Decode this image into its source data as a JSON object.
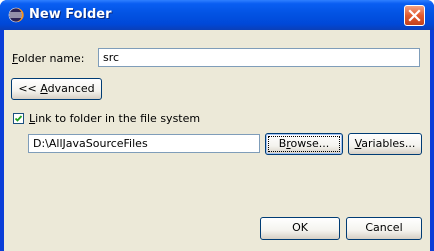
{
  "window": {
    "title": "New Folder",
    "icon": "eclipse-icon"
  },
  "folder_name": {
    "label_rest": "older name:",
    "label_mnemonic": "F",
    "value": "src"
  },
  "advanced_button": {
    "label_prefix": "<< ",
    "label_mnemonic": "A",
    "label_rest": "dvanced"
  },
  "link_checkbox": {
    "checked": true,
    "label_mnemonic": "L",
    "label_rest": "ink to folder in the file system"
  },
  "link_path": {
    "value": "D:\\AllJavaSourceFiles"
  },
  "browse_button": {
    "label_mnemonic": "r",
    "label_before": "B",
    "label_after": "owse..."
  },
  "variables_button": {
    "label_mnemonic": "V",
    "label_rest": "ariables..."
  },
  "ok_button": {
    "label": "OK"
  },
  "cancel_button": {
    "label": "Cancel"
  }
}
